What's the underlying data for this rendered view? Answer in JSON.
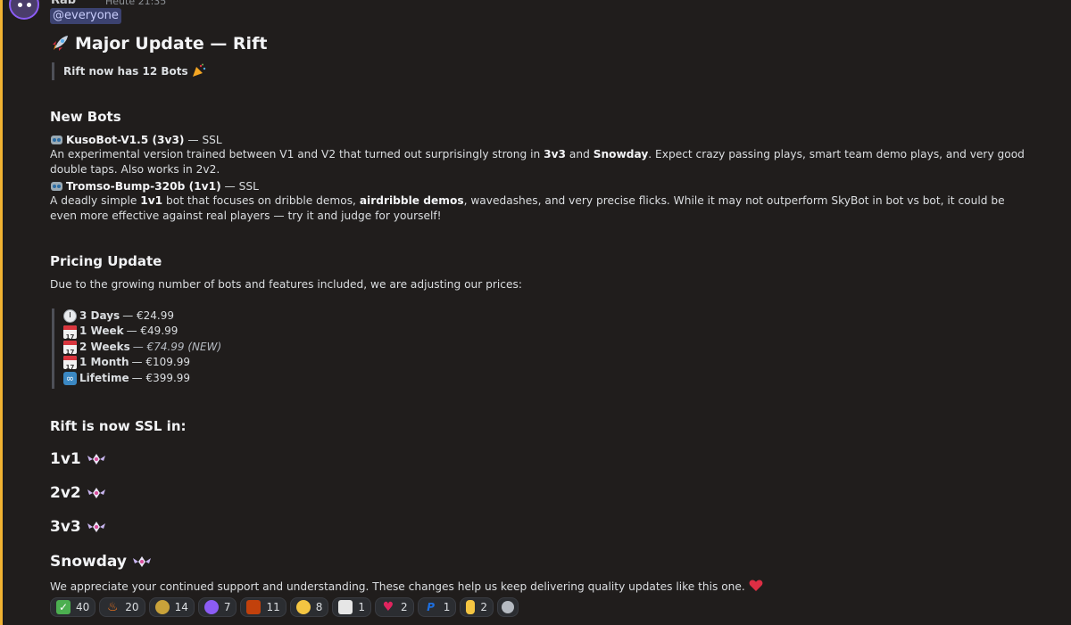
{
  "header": {
    "author": "Rab",
    "time": "Heute 21:35",
    "mention": "@everyone"
  },
  "title": {
    "text": "Major Update — Rift",
    "icon": "rocket-icon"
  },
  "subtitle_quote": "Rift now has 12 Bots",
  "new_bots": {
    "heading": "New Bots",
    "bots": [
      {
        "name": "KusoBot-V1.5 (3v3)",
        "rank": " — SSL",
        "desc_parts": [
          "An experimental version trained between V1 and V2 that turned out surprisingly strong in ",
          "3v3",
          " and ",
          "Snowday",
          ". Expect crazy passing plays, smart team demo plays, and very good double taps. Also works in 2v2."
        ]
      },
      {
        "name": "Tromso-Bump-320b (1v1)",
        "rank": " — SSL",
        "desc_parts": [
          "A deadly simple ",
          "1v1",
          " bot that focuses on dribble demos, ",
          "airdribble demos",
          ", wavedashes, and very precise flicks. While it may not outperform SkyBot in bot vs bot, it could be even more effective against real players — try it and judge for yourself!"
        ]
      }
    ]
  },
  "pricing": {
    "heading": "Pricing Update",
    "intro": "Due to the growing number of bots and features included, we are adjusting our prices:",
    "plans": [
      {
        "icon": "clock-icon",
        "label": "3 Days",
        "price": " — €24.99",
        "note": ""
      },
      {
        "icon": "calendar-icon",
        "label": "1 Week",
        "price": " — €49.99",
        "note": ""
      },
      {
        "icon": "calendar-icon",
        "label": "2 Weeks",
        "price": " — €74.99",
        "note": " (NEW)"
      },
      {
        "icon": "calendar-icon",
        "label": "1 Month",
        "price": " — €109.99",
        "note": ""
      },
      {
        "icon": "infinity-icon",
        "label": "Lifetime",
        "price": " — €399.99",
        "note": ""
      }
    ]
  },
  "ssl": {
    "heading": "Rift is now SSL in:",
    "modes": [
      "1v1",
      "2v2",
      "3v3",
      "Snowday"
    ]
  },
  "closing": "We appreciate your continued support and understanding. These changes help us keep delivering quality updates like this one.",
  "calendar_day": "17",
  "reactions": [
    {
      "icon": "check-icon",
      "count": "40",
      "color": "#4caf50"
    },
    {
      "icon": "fire-icon",
      "count": "20",
      "color": "#ff7a1a"
    },
    {
      "icon": "coin-face-icon",
      "count": "14",
      "color": "#c9a23a"
    },
    {
      "icon": "purple-emote-icon",
      "count": "7",
      "color": "#8c5cf5"
    },
    {
      "icon": "chat-emote-icon",
      "count": "11",
      "color": "#c2410c"
    },
    {
      "icon": "crying-face-icon",
      "count": "8",
      "color": "#f4c542"
    },
    {
      "icon": "tv-emote-icon",
      "count": "1",
      "color": "#e6e6e6"
    },
    {
      "icon": "heart-icon",
      "count": "2",
      "color": "#e0245e"
    },
    {
      "icon": "paypal-icon",
      "count": "1",
      "color": "#1d6fe0"
    },
    {
      "icon": "finger-icon",
      "count": "2",
      "color": "#f4c542"
    }
  ]
}
